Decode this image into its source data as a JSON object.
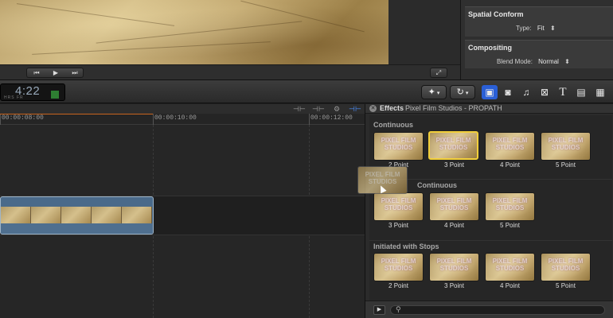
{
  "viewer": {
    "controls": {
      "prev_icon": "skip-back-icon",
      "play_icon": "play-icon",
      "next_icon": "skip-forward-icon",
      "fullscreen_icon": "fullscreen-icon"
    }
  },
  "inspector": {
    "spatial_conform": {
      "title": "Spatial Conform",
      "type_label": "Type:",
      "type_value": "Fit"
    },
    "compositing": {
      "title": "Compositing",
      "blend_label": "Blend Mode:",
      "blend_value": "Normal"
    }
  },
  "toolbar": {
    "timecode": "4:22",
    "tc_labels": "HRS  FR",
    "icons": [
      "magic-wand-icon",
      "retime-icon",
      "video-icon",
      "camera-icon",
      "music-icon",
      "transition-icon",
      "title-icon",
      "generator-icon",
      "theme-icon"
    ]
  },
  "timeline": {
    "ruler": [
      "00:00:08:00",
      "00:00:10:00",
      "00:00:12:00"
    ]
  },
  "effects": {
    "title": "Effects",
    "subtitle": "Pixel Film Studios - PROPATH",
    "thumb_watermark": "PIXEL FILM STUDIOS",
    "categories": [
      {
        "name": "Continuous",
        "items": [
          "2 Point",
          "3 Point",
          "4 Point",
          "5 Point"
        ]
      },
      {
        "name": "Continuous",
        "items": [
          "3 Point",
          "4 Point",
          "5 Point"
        ]
      },
      {
        "name": "Initiated with Stops",
        "items": [
          "2 Point",
          "3 Point",
          "4 Point",
          "5 Point"
        ]
      }
    ],
    "search_placeholder": ""
  }
}
